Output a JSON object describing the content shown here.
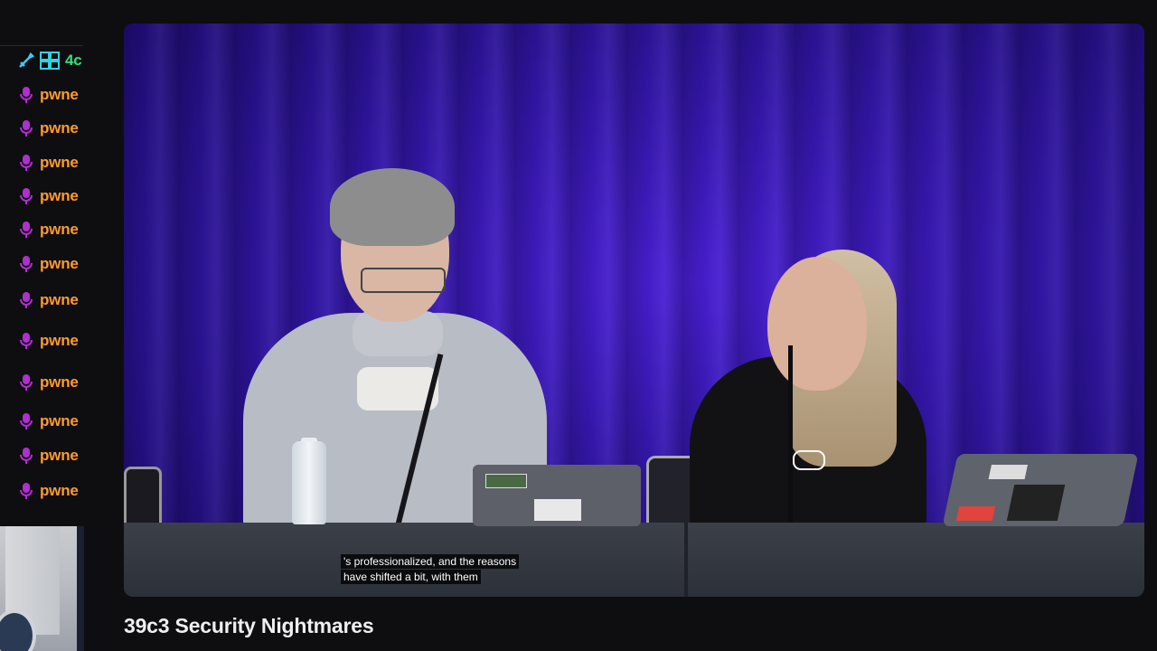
{
  "chat": {
    "messages": [
      {
        "name": "4c",
        "badge": "cc-icon",
        "color": "#34e07a"
      },
      {
        "name": "pwne",
        "badge": "mic-icon",
        "color": "#ff9a2e"
      },
      {
        "name": "pwne",
        "badge": "mic-icon",
        "color": "#ff9a2e"
      },
      {
        "name": "pwne",
        "badge": "mic-icon",
        "color": "#ff9a2e"
      },
      {
        "name": "pwne",
        "badge": "mic-icon",
        "color": "#ff9a2e"
      },
      {
        "name": "pwne",
        "badge": "mic-icon",
        "color": "#ff9a2e"
      },
      {
        "name": "pwne",
        "badge": "mic-icon",
        "color": "#ff9a2e"
      },
      {
        "name": "pwne",
        "badge": "mic-icon",
        "color": "#ff9a2e"
      },
      {
        "name": "pwne",
        "badge": "mic-icon",
        "color": "#ff9a2e"
      },
      {
        "name": "pwne",
        "badge": "mic-icon",
        "color": "#ff9a2e"
      },
      {
        "name": "pwne",
        "badge": "mic-icon",
        "color": "#ff9a2e"
      },
      {
        "name": "pwne",
        "badge": "mic-icon",
        "color": "#ff9a2e"
      },
      {
        "name": "pwne",
        "badge": "mic-icon",
        "color": "#ff9a2e"
      }
    ]
  },
  "video": {
    "subtitle_line1": "'s professionalized, and the reasons",
    "subtitle_line2": "have shifted a bit, with them"
  },
  "stream": {
    "title": "39c3 Security Nightmares"
  },
  "colors": {
    "background": "#0e0e10",
    "curtain": "#3216a8",
    "chat_name": "#ff9a2e",
    "chat_name_alt": "#34e07a",
    "mic_badge": "#b02fd0"
  }
}
